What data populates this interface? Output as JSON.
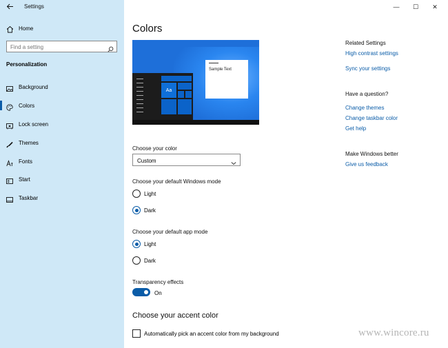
{
  "window": {
    "app_title": "Settings",
    "controls": {
      "minimize": "—",
      "maximize": "☐",
      "close": "✕"
    }
  },
  "sidebar": {
    "home_label": "Home",
    "search_placeholder": "Find a setting",
    "section_title": "Personalization",
    "items": [
      {
        "label": "Background",
        "icon": "image-icon"
      },
      {
        "label": "Colors",
        "icon": "palette-icon",
        "active": true
      },
      {
        "label": "Lock screen",
        "icon": "lock-screen-icon"
      },
      {
        "label": "Themes",
        "icon": "themes-icon"
      },
      {
        "label": "Fonts",
        "icon": "fonts-icon"
      },
      {
        "label": "Start",
        "icon": "start-icon"
      },
      {
        "label": "Taskbar",
        "icon": "taskbar-icon"
      }
    ]
  },
  "main": {
    "title": "Colors",
    "preview_sample_text": "Sample Text",
    "preview_tile_text": "Aa",
    "choose_color_label": "Choose your color",
    "choose_color_value": "Custom",
    "windows_mode_label": "Choose your default Windows mode",
    "windows_mode_options": [
      "Light",
      "Dark"
    ],
    "windows_mode_selected": "Dark",
    "app_mode_label": "Choose your default app mode",
    "app_mode_options": [
      "Light",
      "Dark"
    ],
    "app_mode_selected": "Light",
    "transparency_label": "Transparency effects",
    "transparency_state": "On",
    "accent_title": "Choose your accent color",
    "auto_accent_label": "Automatically pick an accent color from my background"
  },
  "related": {
    "related_head": "Related Settings",
    "related_links": [
      "High contrast settings",
      "Sync your settings"
    ],
    "question_head": "Have a question?",
    "question_links": [
      "Change themes",
      "Change taskbar color",
      "Get help"
    ],
    "better_head": "Make Windows better",
    "better_links": [
      "Give us feedback"
    ]
  },
  "watermark": "www.wincore.ru",
  "colors": {
    "accent": "#0a5ca8",
    "sidebar_bg": "#cfe8f7",
    "link": "#0a5ca8"
  }
}
